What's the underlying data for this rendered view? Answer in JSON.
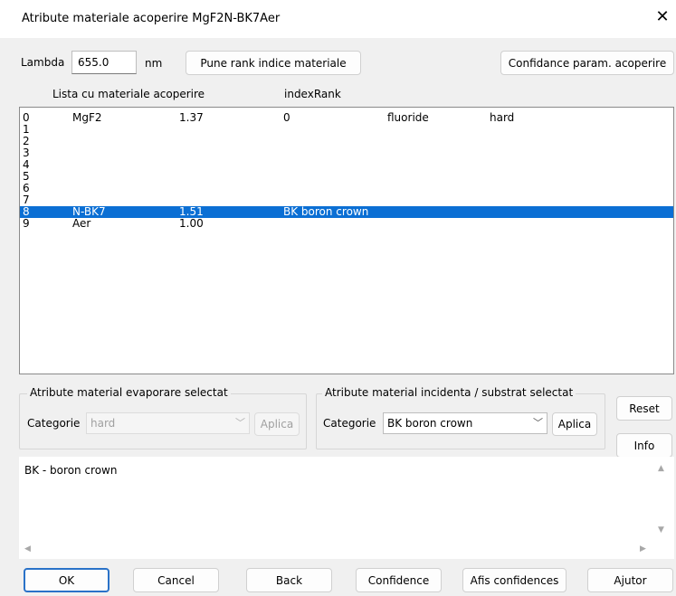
{
  "window": {
    "title": "Atribute materiale acoperire MgF2N-BK7Aer",
    "close_icon": "close-icon"
  },
  "lambda": {
    "label": "Lambda",
    "value": "655.0",
    "unit": "nm"
  },
  "buttons": {
    "rank": "Pune rank indice materiale",
    "confidance": "Confidance param. acoperire",
    "reset": "Reset",
    "info": "Info",
    "apply_evap": "Aplica",
    "apply_incid": "Aplica"
  },
  "list": {
    "header_materials": "Lista cu materiale acoperire",
    "header_rank": "indexRank",
    "rows": [
      {
        "idx": "0",
        "name": "MgF2",
        "n": "1.37",
        "rank": "0",
        "type": "fluoride",
        "hard": "hard",
        "selected": false
      },
      {
        "idx": "1",
        "name": "",
        "n": "",
        "rank": "",
        "type": "",
        "hard": "",
        "selected": false
      },
      {
        "idx": "2",
        "name": "",
        "n": "",
        "rank": "",
        "type": "",
        "hard": "",
        "selected": false
      },
      {
        "idx": "3",
        "name": "",
        "n": "",
        "rank": "",
        "type": "",
        "hard": "",
        "selected": false
      },
      {
        "idx": "4",
        "name": "",
        "n": "",
        "rank": "",
        "type": "",
        "hard": "",
        "selected": false
      },
      {
        "idx": "5",
        "name": "",
        "n": "",
        "rank": "",
        "type": "",
        "hard": "",
        "selected": false
      },
      {
        "idx": "6",
        "name": "",
        "n": "",
        "rank": "",
        "type": "",
        "hard": "",
        "selected": false
      },
      {
        "idx": "7",
        "name": "",
        "n": "",
        "rank": "",
        "type": "",
        "hard": "",
        "selected": false
      },
      {
        "idx": "8",
        "name": "N-BK7",
        "n": "1.51",
        "rank": "BK boron crown",
        "type": "",
        "hard": "",
        "selected": true
      },
      {
        "idx": "9",
        "name": "Aer",
        "n": "1.00",
        "rank": "",
        "type": "",
        "hard": "",
        "selected": false
      }
    ]
  },
  "evap_group": {
    "title": "Atribute material evaporare selectat",
    "category_label": "Categorie",
    "category_value": "hard"
  },
  "incid_group": {
    "title": "Atribute material incidenta / substrat selectat",
    "category_label": "Categorie",
    "category_value": "BK boron crown"
  },
  "description": {
    "text": "BK - boron crown"
  },
  "footer": {
    "ok": "OK",
    "cancel": "Cancel",
    "back": "Back",
    "confidence": "Confidence",
    "afis": "Afis confidences",
    "ajutor": "Ajutor"
  },
  "colors": {
    "selection": "#0b6fd4",
    "default_button_border": "#2a72c8"
  }
}
